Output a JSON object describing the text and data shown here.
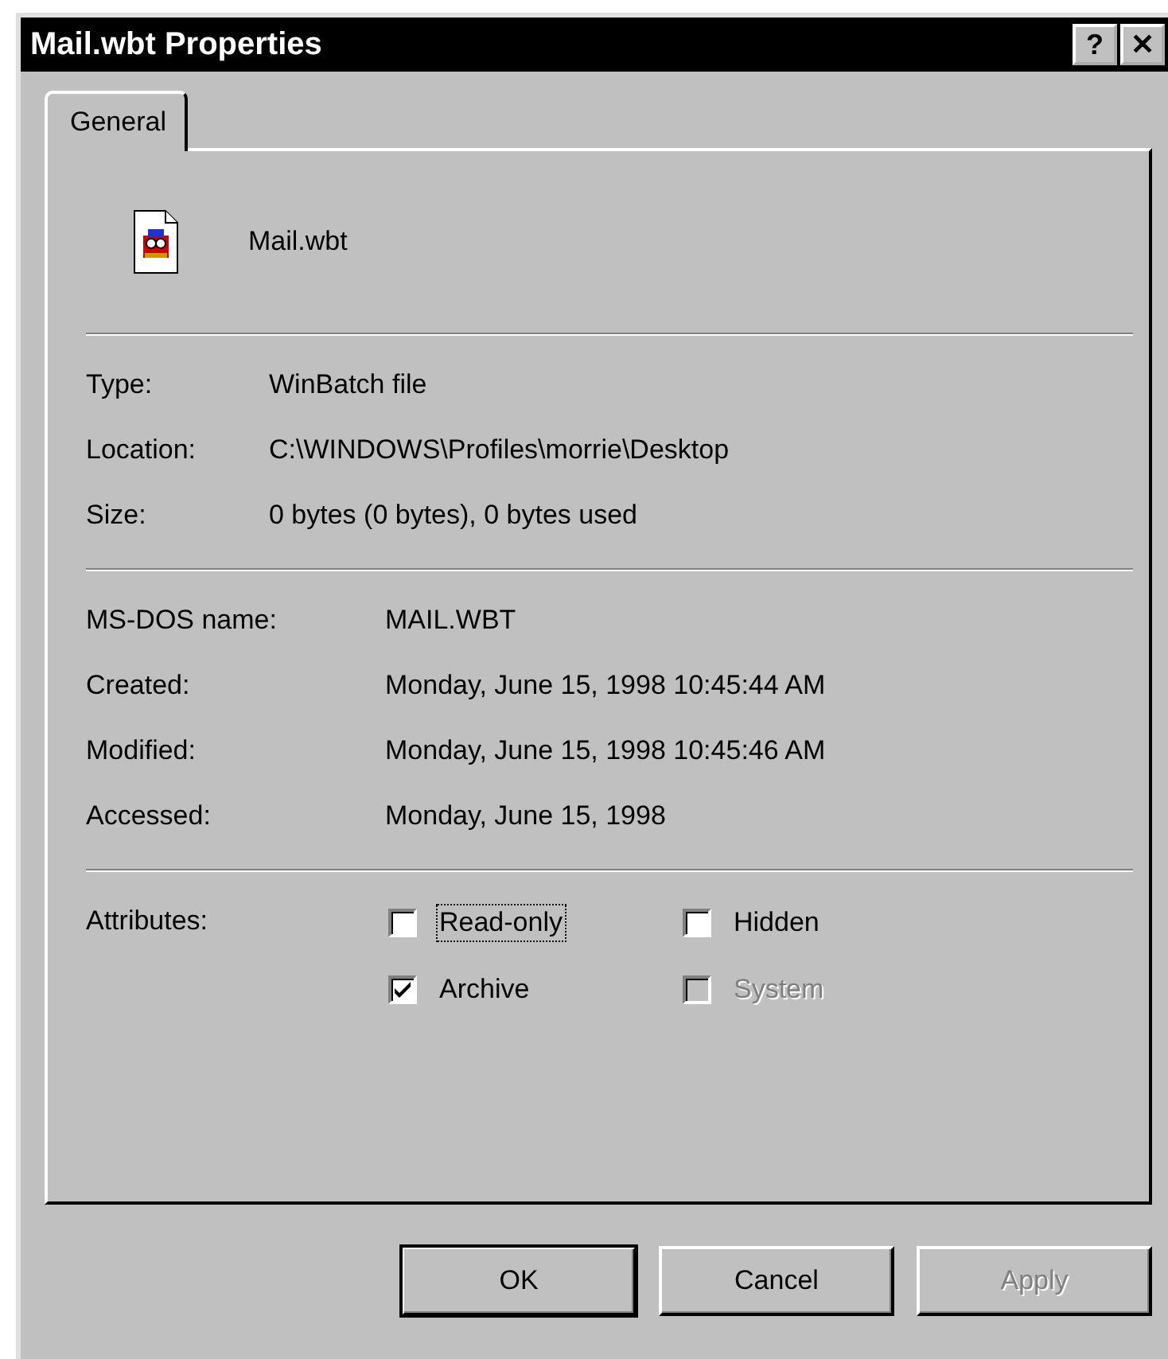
{
  "window": {
    "title": "Mail.wbt Properties",
    "help_button": "?",
    "close_button": "✕"
  },
  "tabs": [
    {
      "label": "General",
      "selected": true
    }
  ],
  "file": {
    "name": "Mail.wbt"
  },
  "details": [
    {
      "label": "Type:",
      "value": "WinBatch file"
    },
    {
      "label": "Location:",
      "value": "C:\\WINDOWS\\Profiles\\morrie\\Desktop"
    },
    {
      "label": "Size:",
      "value": "0 bytes (0 bytes), 0 bytes used"
    }
  ],
  "dates": [
    {
      "label": "MS-DOS name:",
      "value": "MAIL.WBT"
    },
    {
      "label": "Created:",
      "value": "Monday, June 15, 1998 10:45:44 AM"
    },
    {
      "label": "Modified:",
      "value": "Monday, June 15, 1998 10:45:46 AM"
    },
    {
      "label": "Accessed:",
      "value": "Monday, June 15, 1998"
    }
  ],
  "attributes": {
    "label": "Attributes:",
    "items": [
      {
        "label": "Read-only",
        "checked": false,
        "disabled": false,
        "focused": true
      },
      {
        "label": "Hidden",
        "checked": false,
        "disabled": false,
        "focused": false
      },
      {
        "label": "Archive",
        "checked": true,
        "disabled": false,
        "focused": false
      },
      {
        "label": "System",
        "checked": false,
        "disabled": true,
        "focused": false
      }
    ]
  },
  "buttons": [
    {
      "label": "OK",
      "default": true,
      "disabled": false
    },
    {
      "label": "Cancel",
      "default": false,
      "disabled": false
    },
    {
      "label": "Apply",
      "default": false,
      "disabled": true
    }
  ]
}
